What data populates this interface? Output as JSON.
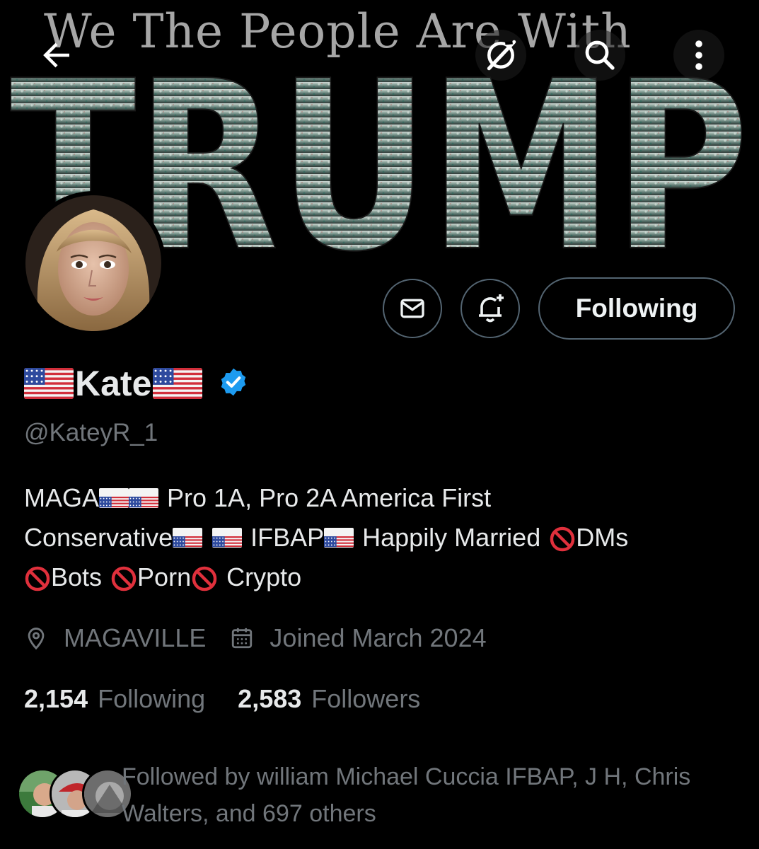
{
  "banner": {
    "tagline": "We The People Are With",
    "headline": "TRUMP"
  },
  "nav": {
    "back_icon": "back-arrow-icon",
    "grok_icon": "grok-icon",
    "search_icon": "search-icon",
    "more_icon": "more-vertical-icon"
  },
  "profile": {
    "display_name": "Kate",
    "name_decoration": "us-flag",
    "verified": true,
    "verified_color": "#1d9bf0",
    "handle": "@KateyR_1",
    "bio_lines": [
      [
        "MAGA",
        "Pro 1A, Pro 2A  America First"
      ],
      [
        "Conservative",
        "IFBAP",
        "Happily Married",
        "DMs"
      ],
      [
        "Bots",
        "Porn",
        "Crypto"
      ]
    ],
    "location": "MAGAVILLE",
    "joined": "Joined March 2024"
  },
  "actions": {
    "follow_label": "Following"
  },
  "stats": {
    "following_count": "2,154",
    "following_label": "Following",
    "followers_count": "2,583",
    "followers_label": "Followers"
  },
  "followed_by": {
    "text": "Followed by william Michael Cuccia IFBAP, J H, Chris Walters, and 697 others"
  },
  "colors": {
    "background": "#000000",
    "text_primary": "#e7e9ea",
    "text_secondary": "#71767b",
    "border": "#536471",
    "verified": "#1d9bf0"
  }
}
